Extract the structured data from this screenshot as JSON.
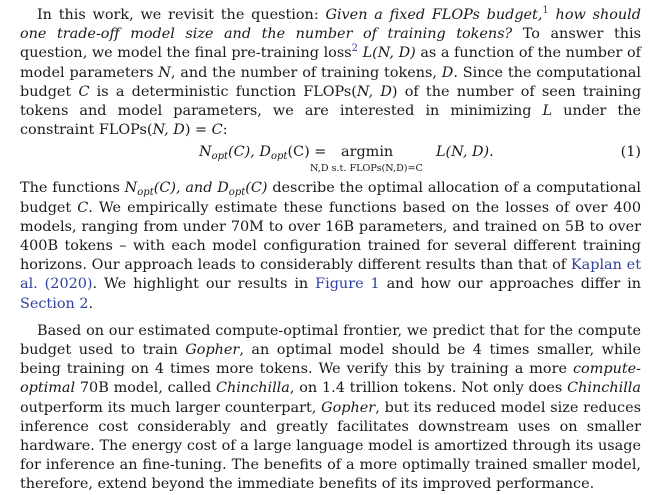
{
  "paragraph1": {
    "t1": "In this work, we revisit the question: ",
    "t2": "Given a fixed FLOPs budget,",
    "fn1": "1",
    "t3": " how should one trade-off model size and the number of training tokens?",
    "t4": " To answer this question, we model the final pre-training loss",
    "fn2": "2",
    "t5": " L(N, D)",
    "t6": " as a function of the number of model parameters ",
    "t7": "N",
    "t8": ", and the number of training tokens, ",
    "t9": "D",
    "t10": ". Since the computational budget ",
    "t11": "C",
    "t12": " is a deterministic function FLOPs(",
    "t13": "N, D",
    "t14": ") of the number of seen training tokens and model parameters, we are interested in minimizing ",
    "t15": "L",
    "t16": " under the constraint FLOPs(",
    "t17": "N, D",
    "t18": ") = ",
    "t19": "C",
    "t20": ":"
  },
  "equation": {
    "lhs_n": "N",
    "lhs_n_sub": "opt",
    "lhs_mid": "(C), D",
    "lhs_d_sub": "opt",
    "lhs_end": "(C) =",
    "argmin": "argmin",
    "constraint": "N,D s.t. FLOPs(N,D)=C",
    "rhs": "L(N, D).",
    "number": "(1)"
  },
  "paragraph2": {
    "t1": "The functions ",
    "n": "N",
    "n_sub": "opt",
    "t2": "(C), and ",
    "d": "D",
    "d_sub": "opt",
    "t3": "(C)",
    "t4": " describe the optimal allocation of a computational budget ",
    "c": "C",
    "t5": ". We empirically estimate these functions based on the losses of over 400 models, ranging from under 70M to over 16B parameters, and trained on 5B to over 400B tokens – with each model configuration trained for several different training horizons. Our approach leads to considerably different results than that of ",
    "ref": "Kaplan et al. (2020)",
    "t6": ". We highlight our results in ",
    "fig": "Figure 1",
    "t7": " and how our approaches differ in ",
    "sec": "Section 2",
    "t8": "."
  },
  "paragraph3": {
    "t1": "Based on our estimated compute-optimal frontier, we predict that for the compute budget used to train ",
    "gopher1": "Gopher",
    "t2": ", an optimal model should be 4 times smaller, while being training on 4 times more tokens. We verify this by training a more ",
    "co": "compute-optimal",
    "t3": " 70B model, called ",
    "chin1": "Chinchilla",
    "t4": ", on 1.4 trillion tokens. Not only does ",
    "chin2": "Chinchilla",
    "t5": " outperform its much larger counterpart, ",
    "gopher2": "Gopher",
    "t6": ", but its reduced model size reduces inference cost considerably and greatly facilitates downstream uses on smaller hardware. The energy cost of a large language model is amortized through its usage for inference an fine-tuning. The benefits of a more optimally trained smaller model, therefore, extend beyond the immediate benefits of its improved performance."
  },
  "colors": {
    "text": "#1a1a1a",
    "link": "#2f3f9f"
  }
}
